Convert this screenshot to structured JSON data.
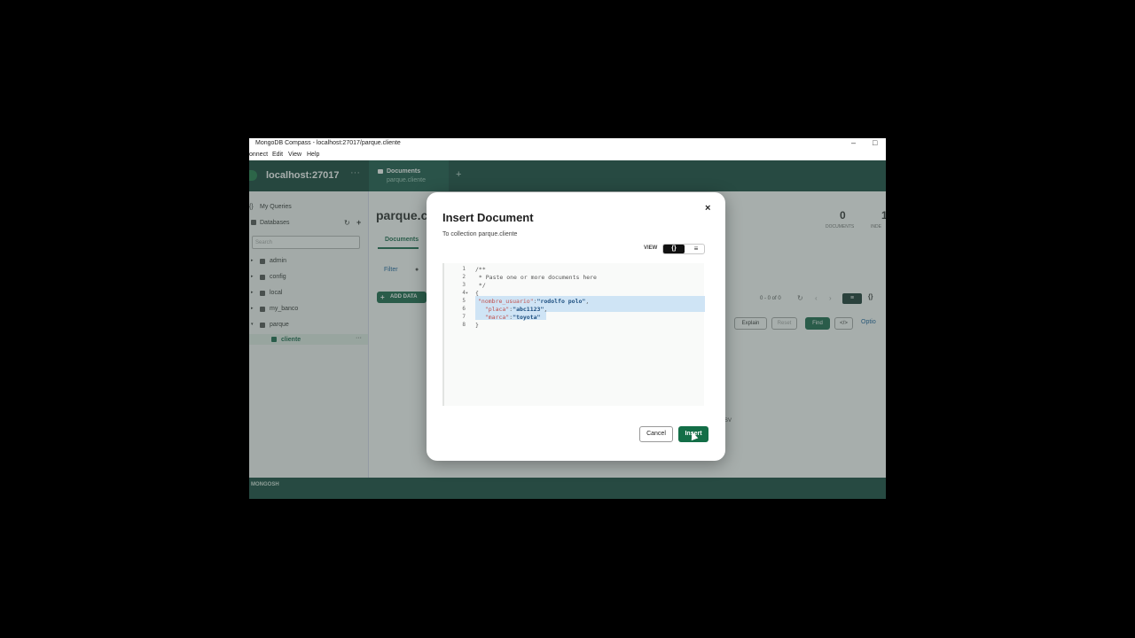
{
  "window": {
    "title": "MongoDB Compass - localhost:27017/parque.cliente",
    "minimize_glyph": "–",
    "maximize_glyph": "□"
  },
  "menu": [
    "onnect",
    "Edit",
    "View",
    "Help"
  ],
  "connection": {
    "host": "localhost:27017",
    "more": "···"
  },
  "sidebar": {
    "my_queries": "My Queries",
    "databases": "Databases",
    "search_placeholder": "Search",
    "items": [
      {
        "label": "admin"
      },
      {
        "label": "config"
      },
      {
        "label": "local"
      },
      {
        "label": "my_banco"
      },
      {
        "label": "parque"
      }
    ],
    "collection": "cliente",
    "collection_more": "···"
  },
  "tab": {
    "label": "Documents",
    "sublabel": "parque.cliente",
    "plus": "+"
  },
  "main": {
    "title": "parque.c",
    "subtab": "Documents",
    "filter": "Filter",
    "add_data": "ADD DATA",
    "explain": "Explain",
    "reset": "Reset",
    "find": "Find",
    "code_toggle": "</>",
    "options": "Optio",
    "pagination": "0 - 0 of 0",
    "docs_count": "0",
    "docs_label": "DOCUMENTS",
    "indexes_count": "1",
    "indexes_label": "INDE",
    "csv": "SV"
  },
  "statusbar": {
    "label": "MONGOSH"
  },
  "modal": {
    "title": "Insert Document",
    "subtitle": "To collection parque.cliente",
    "close": "×",
    "view_label": "VIEW",
    "view_json": "{}",
    "view_list": "≡",
    "lines": [
      {
        "n": "1",
        "text": "/**"
      },
      {
        "n": "2",
        "text": " * Paste one or more documents here"
      },
      {
        "n": "3",
        "text": " */"
      },
      {
        "n": "4",
        "text": "{"
      },
      {
        "n": "5",
        "key": "\"nombre_usuario\"",
        "val": "\"rodolfo polo\"",
        "tail": ","
      },
      {
        "n": "6",
        "key": "  \"placa\"",
        "val": "\"abc1123\"",
        "tail": ","
      },
      {
        "n": "7",
        "key": "  \"marca\"",
        "val": "\"toyota\"",
        "tail": ""
      },
      {
        "n": "8",
        "text": "}"
      }
    ],
    "cancel": "Cancel",
    "insert": "Insert"
  },
  "colors": {
    "accent": "#136e47",
    "sidebar_dark": "#15443a",
    "highlight": "#cfe4f5"
  }
}
